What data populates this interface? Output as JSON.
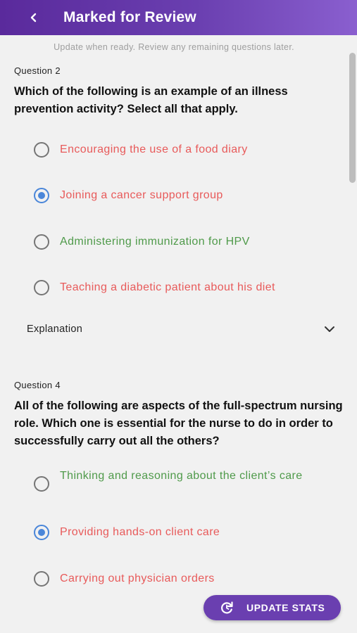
{
  "header": {
    "title": "Marked for Review",
    "back_icon": "chevron-left-icon"
  },
  "notice": "Update when ready. Review any remaining questions later.",
  "questions": [
    {
      "label": "Question 2",
      "text": "Which of the following is an example of an illness prevention activity? Select all that apply.",
      "options": [
        {
          "text": "Encouraging the use of a food diary",
          "selected": false,
          "color": "#e85a5a"
        },
        {
          "text": "Joining a cancer support group",
          "selected": true,
          "color": "#e85a5a"
        },
        {
          "text": "Administering immunization for HPV",
          "selected": false,
          "color": "#4f9a4a"
        },
        {
          "text": "Teaching a diabetic patient about his diet",
          "selected": false,
          "color": "#e85a5a"
        }
      ],
      "explanation_label": "Explanation"
    },
    {
      "label": "Question 4",
      "text": "All of the following are aspects of the full-spectrum nursing role. Which one is essential for the nurse to do in order to successfully carry out all the others?",
      "options": [
        {
          "text": "Thinking and reasoning about the client’s care",
          "selected": false,
          "color": "#4f9a4a"
        },
        {
          "text": "Providing hands-on client care",
          "selected": true,
          "color": "#e85a5a"
        },
        {
          "text": "Carrying out physician orders",
          "selected": false,
          "color": "#e85a5a"
        }
      ]
    }
  ],
  "fab": {
    "label": "UPDATE STATS",
    "icon": "refresh-icon",
    "color": "#6a3fb0"
  },
  "colors": {
    "header_start": "#5a2a9c",
    "header_end": "#8a5fcf",
    "selected_radio": "#4a86d9",
    "incorrect": "#e85a5a",
    "correct": "#4f9a4a"
  }
}
